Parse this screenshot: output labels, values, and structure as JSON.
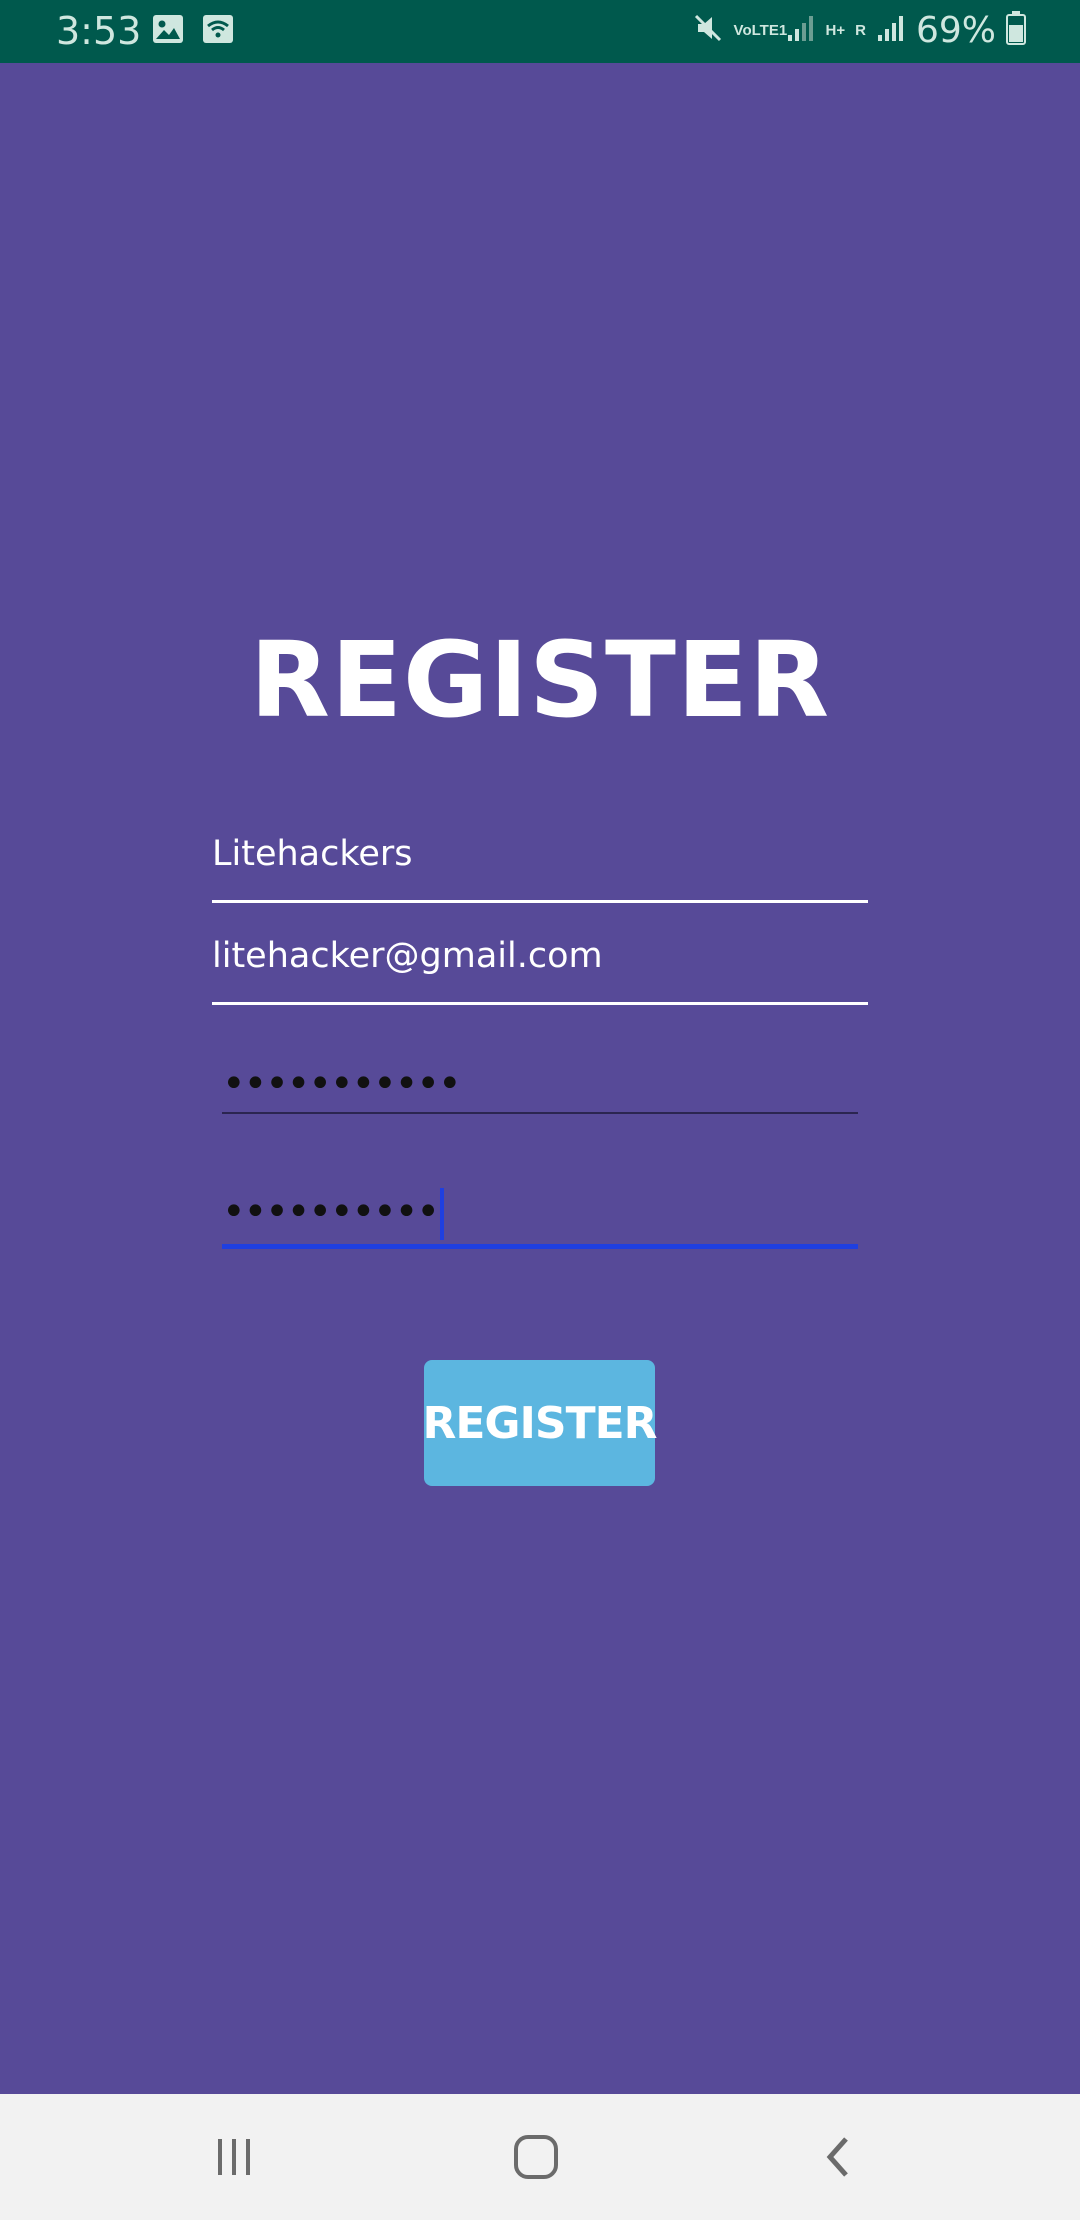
{
  "status_bar": {
    "time": "3:53",
    "lte_label": "VoLTE1",
    "hplus_label": "H+",
    "roaming_label": "R",
    "battery": "69%",
    "icons": [
      "gallery-icon",
      "wifi-call-icon",
      "mute-icon",
      "signal-icon",
      "battery-icon"
    ]
  },
  "page": {
    "title": "REGISTER"
  },
  "form": {
    "name_value": "Litehackers",
    "email_value": "litehacker@gmail.com",
    "password_value": "•••••••••••",
    "confirm_password_value": "••••••••••",
    "submit_label": "REGISTER"
  },
  "nav_bar": {
    "icons": [
      "recents-icon",
      "home-icon",
      "back-icon"
    ]
  },
  "colors": {
    "background": "#574A98",
    "status_bar": "#00594D",
    "button": "#5CB6E0",
    "focus_line": "#1F3FE0"
  }
}
